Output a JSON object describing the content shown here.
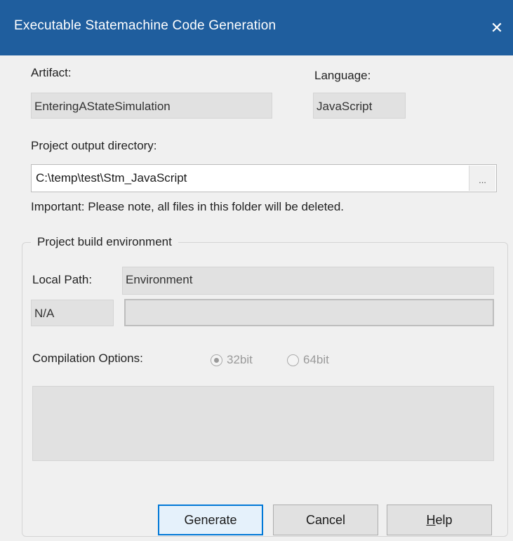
{
  "window": {
    "title": "Executable Statemachine Code Generation",
    "close_icon": "close-icon",
    "close_glyph": "✕"
  },
  "artifact": {
    "label": "Artifact:",
    "value": "EnteringAStateSimulation"
  },
  "language": {
    "label": "Language:",
    "value": "JavaScript"
  },
  "output": {
    "label": "Project output directory:",
    "value": "C:\\temp\\test\\Stm_JavaScript",
    "browse_label": "...",
    "warning": "Important: Please note, all files in this folder will be deleted."
  },
  "build_env": {
    "group_title": "Project build environment",
    "local_path_label": "Local Path:",
    "local_path_value": "N/A",
    "environment_header": "Environment",
    "environment_value": "",
    "compilation_label": "Compilation Options:",
    "options": [
      {
        "label": "32bit",
        "selected": true
      },
      {
        "label": "64bit",
        "selected": false
      }
    ]
  },
  "buttons": {
    "generate": "Generate",
    "cancel": "Cancel",
    "help_mnemonic": "H",
    "help_rest": "elp"
  }
}
